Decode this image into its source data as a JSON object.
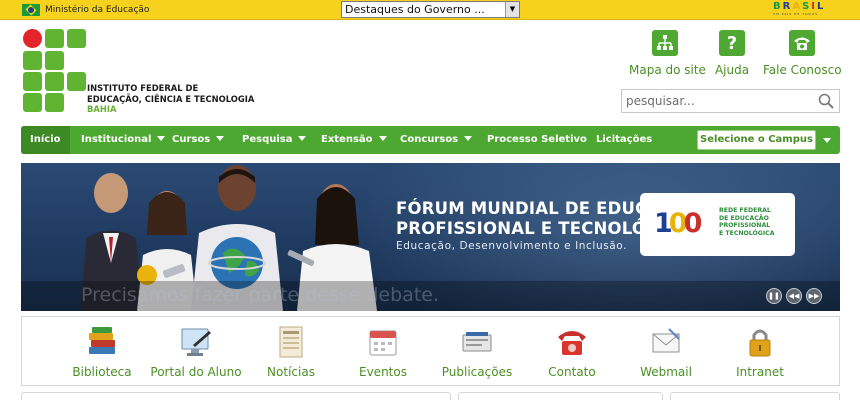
{
  "gov_bar": {
    "ministry": "Ministério da Educação",
    "highlights_select": "Destaques do Governo ...",
    "brasil_logo": "BRASIL",
    "brasil_tagline": "UM PAÍS DE TODOS"
  },
  "header": {
    "institute_line1": "INSTITUTO FEDERAL DE",
    "institute_line2": "EDUCAÇÃO, CIÊNCIA E TECNOLOGIA",
    "institute_line3": "BAHIA",
    "top_links": [
      {
        "label": "Mapa do site",
        "icon": "sitemap-icon"
      },
      {
        "label": "Ajuda",
        "icon": "help-icon"
      },
      {
        "label": "Fale Conosco",
        "icon": "phone-icon"
      }
    ],
    "search_placeholder": "pesquisar..."
  },
  "nav": {
    "items": [
      {
        "label": "Início",
        "dropdown": false
      },
      {
        "label": "Institucional",
        "dropdown": true
      },
      {
        "label": "Cursos",
        "dropdown": true
      },
      {
        "label": "Pesquisa",
        "dropdown": true
      },
      {
        "label": "Extensão",
        "dropdown": true
      },
      {
        "label": "Concursos",
        "dropdown": true
      },
      {
        "label": "Processo Seletivo",
        "dropdown": false
      },
      {
        "label": "Licitações",
        "dropdown": false
      }
    ],
    "campus_select": "Selecione o Campus"
  },
  "banner": {
    "title_line1": "FÓRUM MUNDIAL DE EDUCAÇÃO",
    "title_line2": "PROFISSIONAL E TECNOLÓGICA",
    "subtitle": "Educação, Desenvolvimento e Inclusão.",
    "card_number": "100",
    "card_line1": "REDE FEDERAL",
    "card_line2": "DE EDUCAÇÃO",
    "card_line3": "PROFISSIONAL",
    "card_line4": "E TECNOLÓGICA",
    "caption_ghost": "desse debate.",
    "controls": [
      "pause",
      "previous",
      "next"
    ]
  },
  "quick_links": [
    {
      "label": "Biblioteca",
      "icon": "books-icon"
    },
    {
      "label": "Portal do Aluno",
      "icon": "student-portal-icon"
    },
    {
      "label": "Notícias",
      "icon": "newspaper-icon"
    },
    {
      "label": "Eventos",
      "icon": "calendar-icon"
    },
    {
      "label": "Publicações",
      "icon": "publications-icon"
    },
    {
      "label": "Contato",
      "icon": "telephone-icon"
    },
    {
      "label": "Webmail",
      "icon": "mail-icon"
    },
    {
      "label": "Intranet",
      "icon": "lock-icon"
    }
  ],
  "colors": {
    "gov_yellow": "#f6d21d",
    "brand_green": "#4da832",
    "link_green": "#4a8f25",
    "logo_red": "#e32429",
    "banner_blue": "#1f3a60"
  }
}
